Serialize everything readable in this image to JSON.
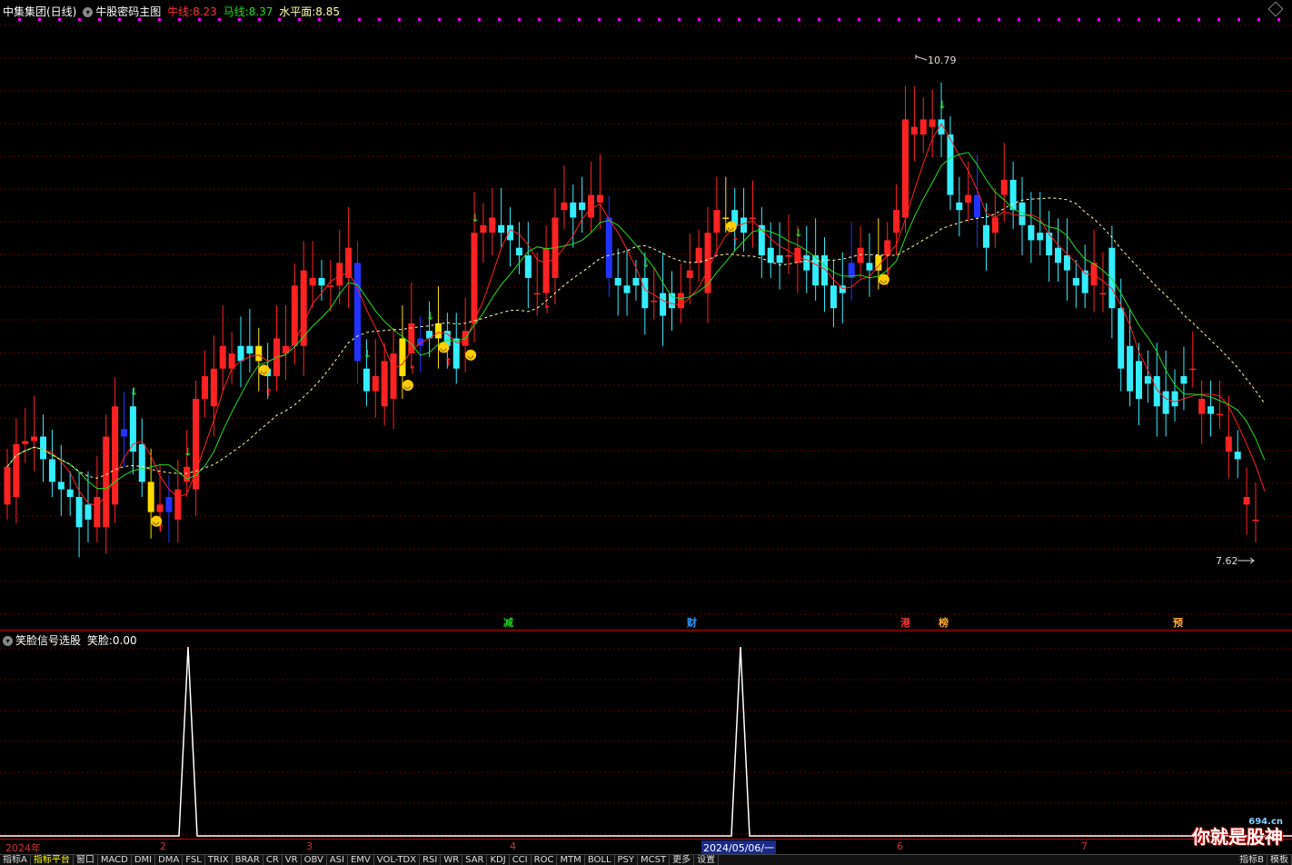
{
  "header": {
    "stock_name": "中集集团(日线)",
    "indicator_name": "牛股密码主图",
    "bull_label": "牛线:",
    "bull_value": "8.23",
    "horse_label": "马线:",
    "horse_value": "8.37",
    "level_label": "水平面:",
    "level_value": "8.85"
  },
  "sub_header": {
    "indicator_name": "笑脸信号选股",
    "smile_label": "笑脸:",
    "smile_value": "0.00"
  },
  "price_labels": {
    "high": "10.79",
    "low": "7.62"
  },
  "markers": [
    {
      "text": "减",
      "color": "#22cc22"
    },
    {
      "text": "财",
      "color": "#3399ff"
    },
    {
      "text": "港",
      "color": "#ff3333"
    },
    {
      "text": "榜",
      "color": "#ffaa33"
    },
    {
      "text": "预",
      "color": "#ffaa33"
    }
  ],
  "dates": {
    "year": "2024年",
    "m2": "2",
    "m3": "3",
    "m4": "4",
    "cursor": "2024/05/06/一",
    "m6": "6",
    "m7": "7"
  },
  "tabs": [
    "指标A",
    "指标平台",
    "窗口",
    "MACD",
    "DMI",
    "DMA",
    "FSL",
    "TRIX",
    "BRAR",
    "CR",
    "VR",
    "OBV",
    "ASI",
    "EMV",
    "VOL-TDX",
    "RSI",
    "WR",
    "SAR",
    "KDJ",
    "CCI",
    "ROC",
    "MTM",
    "BOLL",
    "PSY",
    "MCST",
    "更多",
    "设置"
  ],
  "tabs_right": [
    "指标B",
    "模板"
  ],
  "logo": {
    "text": "你就是股神",
    "site": "694.cn"
  },
  "colors": {
    "up": "#ff2222",
    "down": "#33eeff",
    "blue_bar": "#2233ff",
    "signal_bar": "#ffdd00",
    "bull_line": "#ff2222",
    "horse_line": "#22dd22",
    "level_line": "#ffffaa"
  },
  "chart_data": {
    "type": "candlestick",
    "x": [
      "2024-01-02",
      "2024-01-03",
      "2024-01-04",
      "2024-01-05",
      "2024-01-08",
      "2024-01-09",
      "2024-01-10",
      "2024-01-11",
      "2024-01-12",
      "2024-01-15",
      "2024-01-16",
      "2024-01-17",
      "2024-01-18",
      "2024-01-19",
      "2024-01-22",
      "2024-01-23",
      "2024-01-24",
      "2024-01-25",
      "2024-01-26",
      "2024-01-29",
      "2024-01-30",
      "2024-01-31",
      "2024-02-01",
      "2024-02-02",
      "2024-02-05",
      "2024-02-06",
      "2024-02-07",
      "2024-02-08",
      "2024-02-19",
      "2024-02-20",
      "2024-02-21",
      "2024-02-22",
      "2024-02-23",
      "2024-02-26",
      "2024-02-27",
      "2024-02-28",
      "2024-02-29",
      "2024-03-01",
      "2024-03-04",
      "2024-03-05",
      "2024-03-06",
      "2024-03-07",
      "2024-03-08",
      "2024-03-11",
      "2024-03-12",
      "2024-03-13",
      "2024-03-14",
      "2024-03-15",
      "2024-03-18",
      "2024-03-19",
      "2024-03-20",
      "2024-03-21",
      "2024-03-22",
      "2024-03-25",
      "2024-03-26",
      "2024-03-27",
      "2024-03-28",
      "2024-03-29",
      "2024-04-01",
      "2024-04-02",
      "2024-04-03",
      "2024-04-08",
      "2024-04-09",
      "2024-04-10",
      "2024-04-11",
      "2024-04-12",
      "2024-04-15",
      "2024-04-16",
      "2024-04-17",
      "2024-04-18",
      "2024-04-19",
      "2024-04-22",
      "2024-04-23",
      "2024-04-24",
      "2024-04-25",
      "2024-04-26",
      "2024-04-29",
      "2024-04-30",
      "2024-05-06",
      "2024-05-07",
      "2024-05-08",
      "2024-05-09",
      "2024-05-10",
      "2024-05-13",
      "2024-05-14",
      "2024-05-15",
      "2024-05-16",
      "2024-05-17",
      "2024-05-20",
      "2024-05-21",
      "2024-05-22",
      "2024-05-23",
      "2024-05-24",
      "2024-05-27",
      "2024-05-28",
      "2024-05-29",
      "2024-05-30",
      "2024-05-31",
      "2024-06-03",
      "2024-06-04",
      "2024-06-05",
      "2024-06-06",
      "2024-06-07",
      "2024-06-11",
      "2024-06-12",
      "2024-06-13",
      "2024-06-14",
      "2024-06-17",
      "2024-06-18",
      "2024-06-19",
      "2024-06-20",
      "2024-06-21",
      "2024-06-24",
      "2024-06-25",
      "2024-06-26",
      "2024-06-27",
      "2024-06-28",
      "2024-07-01",
      "2024-07-02",
      "2024-07-03",
      "2024-07-04",
      "2024-07-05",
      "2024-07-08",
      "2024-07-09",
      "2024-07-10",
      "2024-07-11",
      "2024-07-12",
      "2024-07-15",
      "2024-07-16",
      "2024-07-17",
      "2024-07-18",
      "2024-07-19",
      "2024-07-22",
      "2024-07-23",
      "2024-07-24",
      "2024-07-25",
      "2024-07-26",
      "2024-07-29"
    ],
    "open": [
      7.9,
      7.95,
      8.3,
      8.32,
      8.35,
      8.2,
      8.05,
      8.0,
      7.95,
      7.9,
      7.75,
      7.75,
      7.9,
      8.35,
      8.55,
      8.3,
      8.05,
      7.85,
      7.85,
      7.8,
      8.05,
      8.0,
      8.6,
      8.55,
      8.8,
      8.8,
      8.95,
      8.95,
      8.95,
      8.8,
      8.75,
      8.9,
      8.95,
      8.95,
      9.35,
      9.4,
      9.35,
      9.35,
      9.4,
      9.5,
      8.8,
      8.65,
      8.55,
      8.6,
      8.75,
      8.9,
      8.95,
      9.05,
      9.0,
      9.05,
      9.0,
      8.95,
      9.1,
      9.7,
      9.7,
      9.75,
      9.75,
      9.6,
      9.55,
      9.3,
      9.3,
      9.4,
      9.85,
      9.9,
      9.9,
      9.8,
      9.9,
      9.8,
      9.4,
      9.35,
      9.4,
      9.4,
      9.25,
      9.3,
      9.3,
      9.2,
      9.4,
      9.5,
      9.3,
      9.7,
      9.8,
      9.85,
      9.8,
      9.8,
      9.75,
      9.6,
      9.55,
      9.55,
      9.5,
      9.55,
      9.55,
      9.55,
      9.35,
      9.35,
      9.4,
      9.5,
      9.5,
      9.45,
      9.55,
      9.7,
      9.8,
      10.35,
      10.35,
      10.4,
      10.45,
      10.35,
      9.9,
      9.9,
      9.95,
      9.75,
      9.7,
      9.95,
      10.05,
      9.9,
      9.75,
      9.7,
      9.7,
      9.6,
      9.55,
      9.4,
      9.45,
      9.35,
      9.3,
      9.6,
      9.2,
      8.95,
      8.85,
      8.75,
      8.75,
      8.65,
      8.65,
      8.75,
      8.8,
      8.5,
      8.55,
      8.5,
      8.25,
      8.25,
      7.9,
      7.8
    ],
    "close": [
      8.15,
      8.3,
      8.32,
      8.35,
      8.2,
      8.05,
      8.0,
      7.95,
      7.75,
      7.8,
      7.95,
      8.35,
      8.55,
      8.4,
      8.25,
      8.05,
      7.85,
      7.9,
      7.95,
      8.0,
      8.15,
      8.6,
      8.75,
      8.8,
      8.95,
      8.9,
      8.85,
      8.9,
      8.85,
      8.75,
      9.0,
      8.95,
      9.35,
      9.45,
      9.4,
      9.35,
      9.35,
      9.5,
      9.6,
      8.85,
      8.65,
      8.75,
      8.85,
      8.9,
      9.0,
      9.1,
      9.0,
      9.0,
      9.1,
      8.95,
      8.8,
      9.05,
      9.7,
      9.75,
      9.8,
      9.7,
      9.65,
      9.55,
      9.4,
      9.3,
      9.6,
      9.8,
      9.9,
      9.8,
      9.85,
      9.95,
      9.95,
      9.4,
      9.35,
      9.3,
      9.35,
      9.2,
      9.25,
      9.15,
      9.2,
      9.3,
      9.45,
      9.6,
      9.7,
      9.85,
      9.8,
      9.75,
      9.7,
      9.8,
      9.55,
      9.5,
      9.5,
      9.55,
      9.6,
      9.45,
      9.35,
      9.35,
      9.2,
      9.3,
      9.5,
      9.6,
      9.45,
      9.55,
      9.65,
      9.85,
      10.45,
      10.4,
      10.45,
      10.45,
      10.35,
      9.95,
      9.85,
      9.95,
      9.8,
      9.6,
      9.8,
      10.05,
      9.85,
      9.75,
      9.65,
      9.65,
      9.55,
      9.5,
      9.45,
      9.35,
      9.3,
      9.5,
      9.3,
      9.2,
      8.8,
      8.65,
      8.6,
      8.7,
      8.55,
      8.5,
      8.55,
      8.7,
      8.8,
      8.6,
      8.5,
      8.5,
      8.35,
      8.2,
      7.95,
      7.8,
      7.65
    ]
  },
  "smile_indicator": {
    "type": "line",
    "x": [
      "2024-01-02",
      "2024-05-06",
      "2024-07-29"
    ],
    "values": [
      0,
      0,
      0
    ],
    "peaks": [
      1,
      1
    ],
    "ylim": [
      0,
      1
    ]
  }
}
